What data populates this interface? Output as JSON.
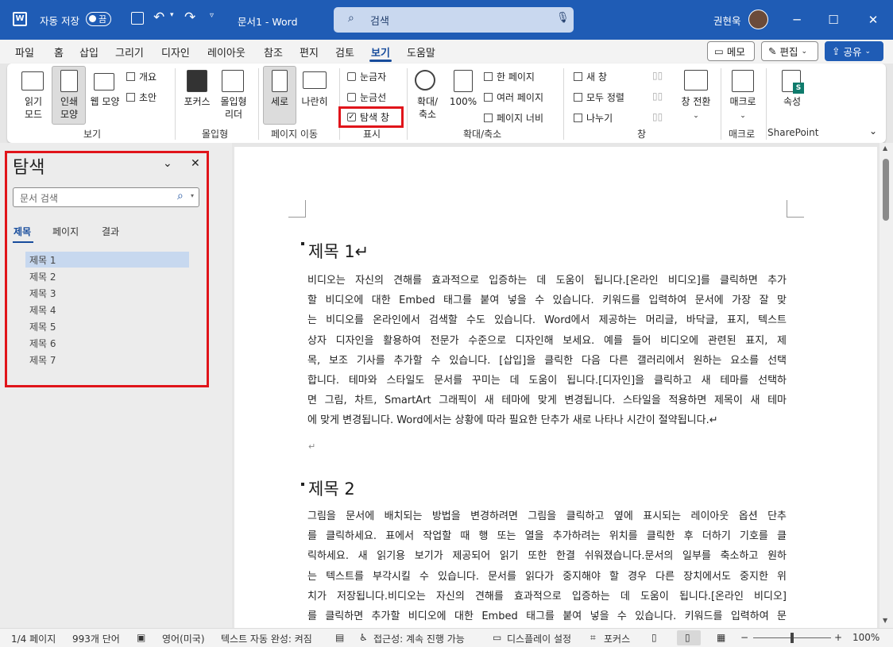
{
  "titlebar": {
    "autosave_label": "자동 저장",
    "autosave_state": "끔",
    "doc_title": "문서1  -  Word",
    "search_placeholder": "검색",
    "user_name": "권현욱",
    "brand_color": "#1f5cb5"
  },
  "menubar": {
    "tabs": [
      "파일",
      "홈",
      "삽입",
      "그리기",
      "디자인",
      "레이아웃",
      "참조",
      "편지",
      "검토",
      "보기",
      "도움말"
    ],
    "active_tab": "보기",
    "memo_button": "메모",
    "edit_button": "편집",
    "share_button": "공유"
  },
  "ribbon": {
    "view_group": {
      "read_mode": "읽기",
      "read_mode2": "모드",
      "print_layout": "인쇄",
      "print_layout2": "모양",
      "web_layout": "웹 모양",
      "outline": "개요",
      "draft": "초안",
      "label": "보기"
    },
    "immersive_group": {
      "focus": "포커스",
      "immersive_reader": "몰입형",
      "immersive_reader2": "리더",
      "label": "몰입형"
    },
    "page_move_group": {
      "vertical": "세로",
      "side_by_side": "나란히",
      "label": "페이지 이동"
    },
    "show_group": {
      "ruler": "눈금자",
      "gridlines": "눈금선",
      "nav_pane": "탐색 창",
      "nav_pane_checked": true,
      "label": "표시"
    },
    "zoom_group": {
      "zoom": "확대/",
      "zoom2": "축소",
      "zoom100": "100%",
      "one_page": "한 페이지",
      "multi_page": "여러 페이지",
      "page_width": "페이지 너비",
      "label": "확대/축소"
    },
    "window_group": {
      "new_window": "새 창",
      "arrange_all": "모두 정렬",
      "split": "나누기",
      "switch_windows": "창 전환",
      "label": "창"
    },
    "macro_group": {
      "macro": "매크로",
      "label": "매크로"
    },
    "sharepoint_group": {
      "properties": "속성",
      "label": "SharePoint"
    }
  },
  "navpane": {
    "title": "탐색",
    "search_placeholder": "문서 검색",
    "tabs": [
      "제목",
      "페이지",
      "결과"
    ],
    "selected_tab": "제목",
    "headings": [
      "제목 1",
      "제목 2",
      "제목 3",
      "제목 4",
      "제목 5",
      "제목 6",
      "제목 7"
    ],
    "selected_heading": "제목 1"
  },
  "document": {
    "heading1": "제목 1↵",
    "para1": [
      "비디오는 자신의 견해를 효과적으로 입증하는 데 도움이 됩니다.[온라인 비디오]를 클릭하면 추가",
      "할 비디오에 대한 Embed 태그를 붙여 넣을 수 있습니다. 키워드를 입력하여 문서에 가장 잘 맞",
      "는 비디오를 온라인에서 검색할 수도 있습니다. Word에서 제공하는 머리글, 바닥글, 표지, 텍스트",
      "상자 디자인을 활용하여 전문가 수준으로 디자인해 보세요. 예를 들어 비디오에 관련된 표지, 제",
      "목, 보조 기사를 추가할 수 있습니다. [삽입]을 클릭한 다음 다른 갤러리에서 원하는 요소를 선택",
      "합니다. 테마와 스타일도 문서를 꾸미는 데 도움이 됩니다.[디자인]을 클릭하고 새 테마를 선택하",
      "면 그림, 차트, SmartArt 그래픽이 새 테마에 맞게 변경됩니다. 스타일을 적용하면 제목이 새 테마",
      "에 맞게 변경됩니다. Word에서는 상황에 따라 필요한 단추가 새로 나타나 시간이 절약됩니다.↵"
    ],
    "empty_para": "↵",
    "heading2": "제목 2",
    "para2": [
      "그림을 문서에 배치되는 방법을 변경하려면 그림을 클릭하고 옆에 표시되는 레이아웃 옵션 단추",
      "를 클릭하세요. 표에서 작업할 때 행 또는 열을 추가하려는 위치를 클릭한 후 더하기 기호를 클",
      "릭하세요. 새 읽기용 보기가 제공되어 읽기 또한 한결 쉬워졌습니다.문서의 일부를 축소하고 원하",
      "는 텍스트를 부각시킬 수 있습니다. 문서를 읽다가 중지해야 할 경우 다른 장치에서도 중지한 위",
      "치가 저장됩니다.비디오는 자신의 견해를 효과적으로 입증하는 데 도움이 됩니다.[온라인 비디오]",
      "를 클릭하면 추가할 비디오에 대한 Embed 태그를 붙여 넣을 수 있습니다. 키워드를 입력하여 문"
    ]
  },
  "statusbar": {
    "page": "1/4 페이지",
    "words": "993개 단어",
    "language": "영어(미국)",
    "autocomplete": "텍스트 자동 완성: 켜짐",
    "accessibility": "접근성: 계속 진행 가능",
    "display_settings": "디스플레이 설정",
    "focus": "포커스",
    "zoom": "100%"
  },
  "colors": {
    "highlight_box": "#e0141a",
    "accent": "#174c9c"
  }
}
